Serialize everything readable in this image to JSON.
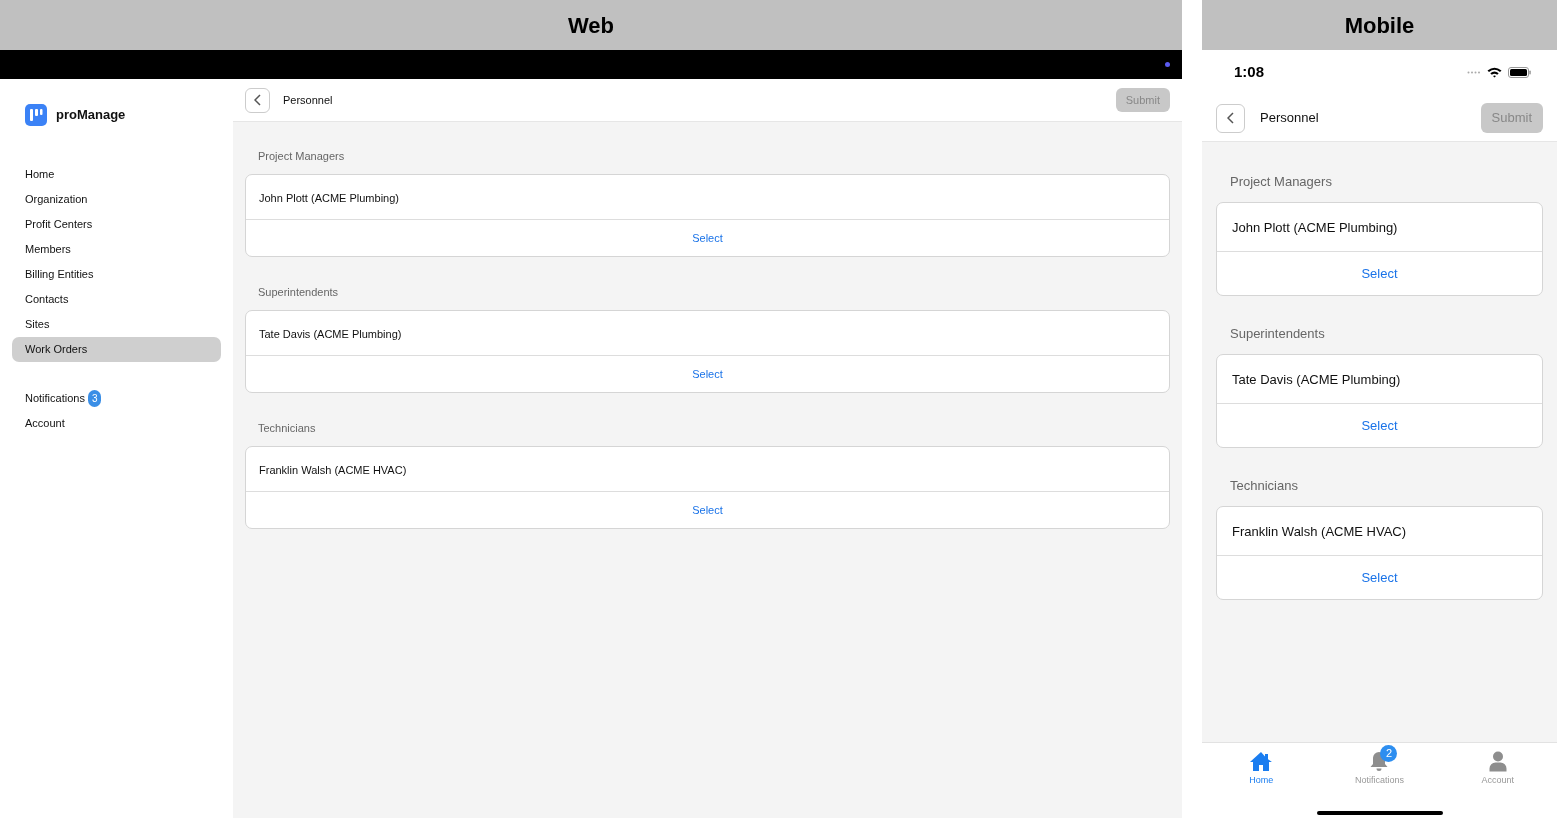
{
  "panels": {
    "web_title": "Web",
    "mobile_title": "Mobile"
  },
  "web": {
    "app_name": "proManage",
    "nav": [
      {
        "label": "Home",
        "selected": false
      },
      {
        "label": "Organization",
        "selected": false
      },
      {
        "label": "Profit Centers",
        "selected": false
      },
      {
        "label": "Members",
        "selected": false
      },
      {
        "label": "Billing Entities",
        "selected": false
      },
      {
        "label": "Contacts",
        "selected": false
      },
      {
        "label": "Sites",
        "selected": false
      },
      {
        "label": "Work Orders",
        "selected": true
      }
    ],
    "nav_secondary": [
      {
        "label": "Notifications",
        "badge": "3"
      },
      {
        "label": "Account"
      }
    ],
    "header": {
      "title": "Personnel",
      "submit": "Submit",
      "submit_disabled": true
    },
    "sections": [
      {
        "title": "Project Managers",
        "person": "John Plott (ACME Plumbing)",
        "action": "Select"
      },
      {
        "title": "Superintendents",
        "person": "Tate Davis (ACME Plumbing)",
        "action": "Select"
      },
      {
        "title": "Technicians",
        "person": "Franklin Walsh (ACME HVAC)",
        "action": "Select"
      }
    ]
  },
  "mobile": {
    "time": "1:08",
    "header": {
      "title": "Personnel",
      "submit": "Submit",
      "submit_disabled": true
    },
    "sections": [
      {
        "title": "Project Managers",
        "person": "John Plott (ACME Plumbing)",
        "action": "Select"
      },
      {
        "title": "Superintendents",
        "person": "Tate Davis (ACME Plumbing)",
        "action": "Select"
      },
      {
        "title": "Technicians",
        "person": "Franklin Walsh (ACME HVAC)",
        "action": "Select"
      }
    ],
    "tabs": [
      {
        "kind": "home",
        "label": "Home",
        "selected": true
      },
      {
        "kind": "bell",
        "label": "Notifications",
        "selected": false,
        "badge": "2"
      },
      {
        "kind": "person",
        "label": "Account",
        "selected": false
      }
    ]
  }
}
